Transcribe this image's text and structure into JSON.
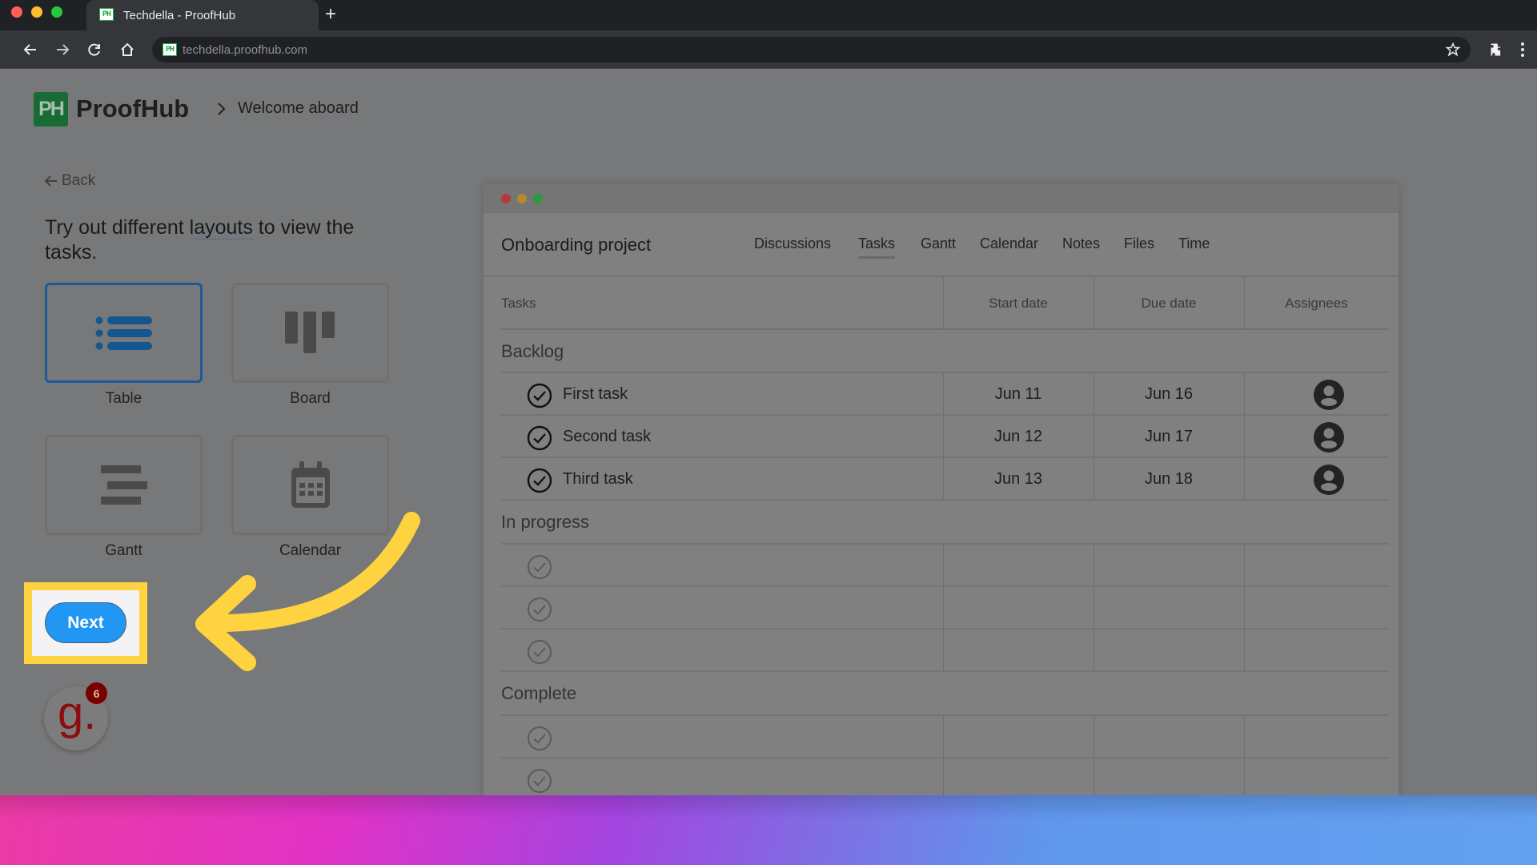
{
  "browser": {
    "tab_title": "Techdella - ProofHub",
    "url": "techdella.proofhub.com",
    "favicon_text": "PH"
  },
  "header": {
    "logo_text": "PH",
    "brand": "ProofHub",
    "breadcrumb": "Welcome aboard"
  },
  "onboarding": {
    "back_label": "Back",
    "heading_before": "Try out different ",
    "heading_link": "layouts",
    "heading_after": " to view the tasks.",
    "layouts": [
      {
        "label": "Table",
        "icon": "list-icon",
        "selected": true
      },
      {
        "label": "Board",
        "icon": "board-icon",
        "selected": false
      },
      {
        "label": "Gantt",
        "icon": "gantt-icon",
        "selected": false
      },
      {
        "label": "Calendar",
        "icon": "calendar-icon",
        "selected": false
      }
    ],
    "next_label": "Next"
  },
  "widget": {
    "letter": "g.",
    "count": "6"
  },
  "mock_app": {
    "project_title": "Onboarding project",
    "tabs": [
      "Discussions",
      "Tasks",
      "Gantt",
      "Calendar",
      "Notes",
      "Files",
      "Time"
    ],
    "active_tab": "Tasks",
    "columns": [
      "Tasks",
      "Start date",
      "Due date",
      "Assignees"
    ],
    "sections": [
      {
        "name": "Backlog",
        "tasks": [
          {
            "name": "First task",
            "start": "Jun 11",
            "due": "Jun 16",
            "assignee": "user-avatar"
          },
          {
            "name": "Second task",
            "start": "Jun 12",
            "due": "Jun 17",
            "assignee": "user-avatar"
          },
          {
            "name": "Third task",
            "start": "Jun 13",
            "due": "Jun 18",
            "assignee": "user-avatar"
          }
        ]
      },
      {
        "name": "In progress",
        "tasks": [
          {},
          {},
          {}
        ]
      },
      {
        "name": "Complete",
        "tasks": [
          {},
          {}
        ]
      }
    ]
  },
  "colors": {
    "highlight": "#ffd23f",
    "next_button": "#2196f3",
    "selected_tile": "#1a5a96",
    "brand_green": "#186b34"
  }
}
